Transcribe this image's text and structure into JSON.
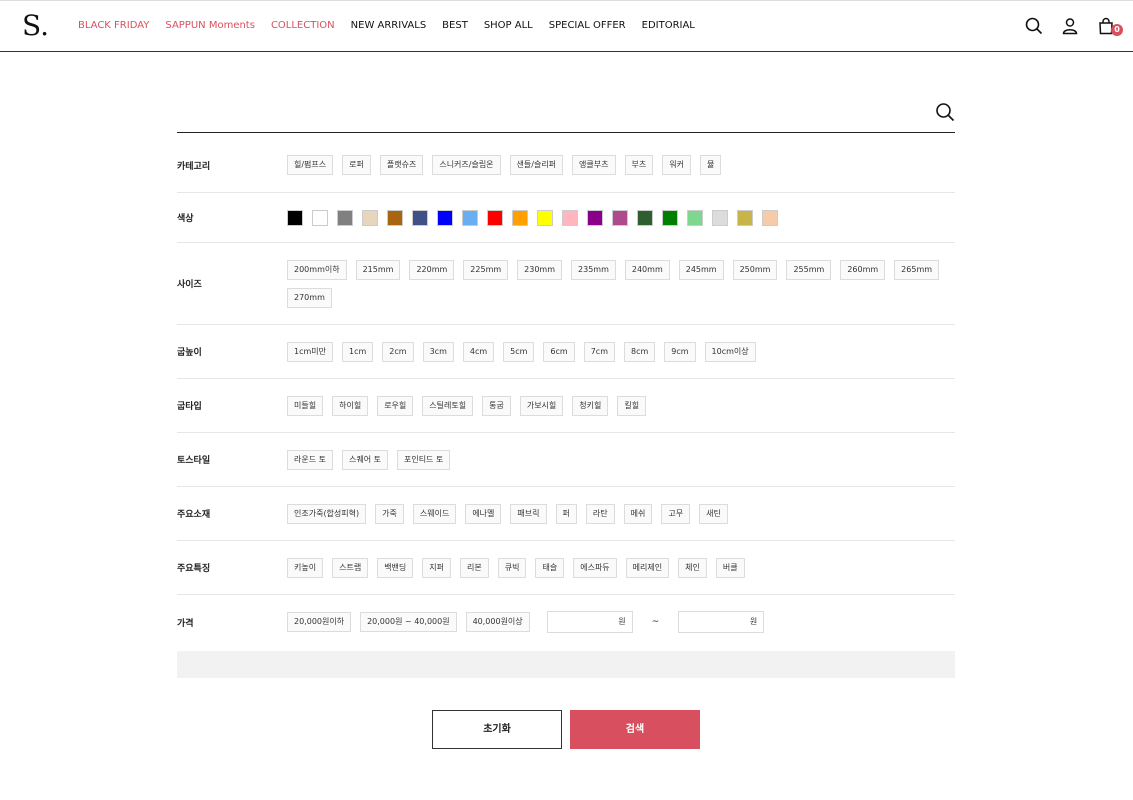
{
  "header": {
    "logo": "S.",
    "nav": [
      {
        "label": "BLACK FRIDAY",
        "accent": true
      },
      {
        "label": "SAPPUN Moments",
        "accent": true
      },
      {
        "label": "COLLECTION",
        "accent": true
      },
      {
        "label": "NEW ARRIVALS",
        "accent": false
      },
      {
        "label": "BEST",
        "accent": false
      },
      {
        "label": "SHOP ALL",
        "accent": false
      },
      {
        "label": "SPECIAL OFFER",
        "accent": false
      },
      {
        "label": "EDITORIAL",
        "accent": false
      }
    ],
    "cart_count": "0",
    "accent_color": "#d8505f"
  },
  "search": {
    "value": "",
    "placeholder": ""
  },
  "filters": [
    {
      "label": "카테고리",
      "options": [
        "힐/펌프스",
        "로퍼",
        "플랫슈즈",
        "스니커즈/슬립온",
        "샌들/슬리퍼",
        "앵클부츠",
        "부츠",
        "워커",
        "뮬"
      ]
    },
    {
      "label": "색상",
      "colors": [
        "#000000",
        "#ffffff",
        "#808080",
        "#e8d5bd",
        "#a8650f",
        "#3f5186",
        "#0000ff",
        "#6aaef2",
        "#ff0000",
        "#ff9f00",
        "#ffff00",
        "#ffb6c1",
        "#8b008b",
        "#b04a8f",
        "#2f5f2f",
        "#008000",
        "#7ed68f",
        "#dcdcdc",
        "#c9b44a",
        "#f8cba8"
      ]
    },
    {
      "label": "사이즈",
      "options": [
        "200mm이하",
        "215mm",
        "220mm",
        "225mm",
        "230mm",
        "235mm",
        "240mm",
        "245mm",
        "250mm",
        "255mm",
        "260mm",
        "265mm",
        "270mm"
      ]
    },
    {
      "label": "굽높이",
      "options": [
        "1cm미만",
        "1cm",
        "2cm",
        "3cm",
        "4cm",
        "5cm",
        "6cm",
        "7cm",
        "8cm",
        "9cm",
        "10cm이상"
      ]
    },
    {
      "label": "굽타입",
      "options": [
        "미들힐",
        "하이힐",
        "로우힐",
        "스틸레토힐",
        "통굽",
        "가보시힐",
        "청키힐",
        "킬힐"
      ]
    },
    {
      "label": "토스타일",
      "options": [
        "라운드 토",
        "스퀘어 토",
        "포인티드 토"
      ]
    },
    {
      "label": "주요소재",
      "options": [
        "인조가죽(합성피혁)",
        "가죽",
        "스웨이드",
        "에나멜",
        "패브릭",
        "퍼",
        "라탄",
        "메쉬",
        "고무",
        "새틴"
      ]
    },
    {
      "label": "주요특징",
      "options": [
        "키높이",
        "스트랩",
        "백밴딩",
        "지퍼",
        "리본",
        "큐빅",
        "태슬",
        "에스파듀",
        "메리제인",
        "체인",
        "버클"
      ]
    },
    {
      "label": "가격",
      "options": [
        "20,000원이하",
        "20,000원 ~ 40,000원",
        "40,000원이상"
      ],
      "unit": "원",
      "range_sep": "~"
    }
  ],
  "buttons": {
    "reset": "초기화",
    "search": "검색"
  }
}
